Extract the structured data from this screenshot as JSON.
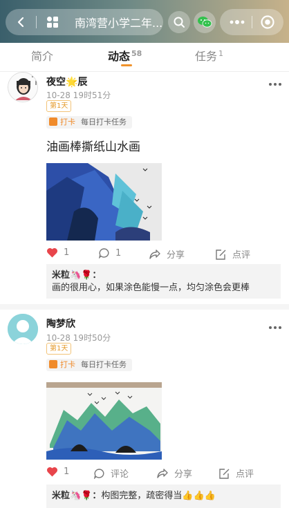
{
  "header": {
    "title": "南湾营小学二年...",
    "icons": {
      "back": "chevron-left-icon",
      "home": "grid-icon",
      "search": "search-icon",
      "share": "wechat-icon",
      "more": "more-icon",
      "close": "close-circle-icon"
    }
  },
  "tabs": [
    {
      "label": "简介",
      "count": ""
    },
    {
      "label": "动态",
      "count": "58"
    },
    {
      "label": "任务",
      "count": "1"
    }
  ],
  "posts": [
    {
      "author": "夜空🌟辰",
      "time": "10-28 19时51分",
      "day_badge": "第1天",
      "task_type": "打卡",
      "task_name": "每日打卡任务",
      "text": "油画棒撕纸山水画",
      "likes": "1",
      "comments": "1",
      "share_label": "分享",
      "review_label": "点评",
      "comment_author": "米粒🦄🌹：",
      "comment_text": "画的很用心，如果涂色能慢一点，均匀涂色会更棒"
    },
    {
      "author": "陶梦欣",
      "time": "10-28 19时50分",
      "day_badge": "第1天",
      "task_type": "打卡",
      "task_name": "每日打卡任务",
      "likes": "1",
      "comments_label": "评论",
      "share_label": "分享",
      "review_label": "点评",
      "comment_author": "米粒🦄🌹：",
      "comment_text": "构图完整，疏密得当👍👍👍"
    }
  ],
  "colors": {
    "accent": "#f0922b",
    "like": "#e8454b"
  }
}
